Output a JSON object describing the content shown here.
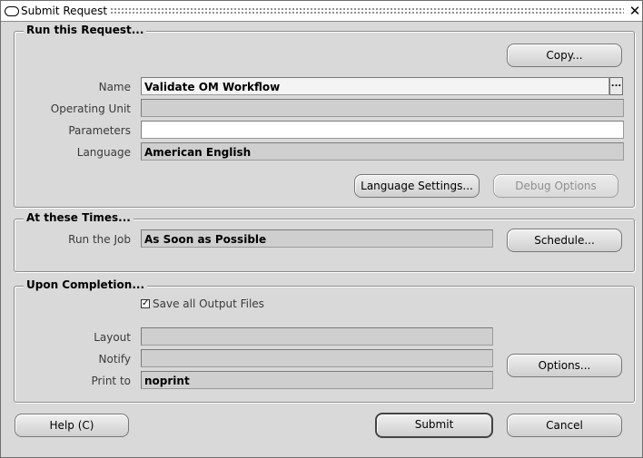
{
  "window": {
    "title": "Submit Request",
    "close_label": "✕"
  },
  "run_request": {
    "group_title": "Run this Request...",
    "copy_label": "Copy...",
    "name_label": "Name",
    "name_value": "Validate OM Workflow",
    "lov_label": "...",
    "operating_unit_label": "Operating Unit",
    "operating_unit_value": "",
    "parameters_label": "Parameters",
    "parameters_value": "",
    "language_label": "Language",
    "language_value": "American English",
    "language_settings_label": "Language Settings...",
    "debug_options_label": "Debug Options"
  },
  "at_times": {
    "group_title": "At these Times...",
    "run_job_label": "Run the Job",
    "run_job_value": "As Soon as Possible",
    "schedule_label": "Schedule..."
  },
  "completion": {
    "group_title": "Upon Completion...",
    "save_output_label": "Save all Output Files",
    "save_output_checked": "✓",
    "layout_label": "Layout",
    "layout_value": "",
    "notify_label": "Notify",
    "notify_value": "",
    "print_to_label": "Print to",
    "print_to_value": "noprint",
    "options_label": "Options..."
  },
  "footer": {
    "help_label": "Help (C)",
    "submit_label": "Submit",
    "cancel_label": "Cancel"
  }
}
